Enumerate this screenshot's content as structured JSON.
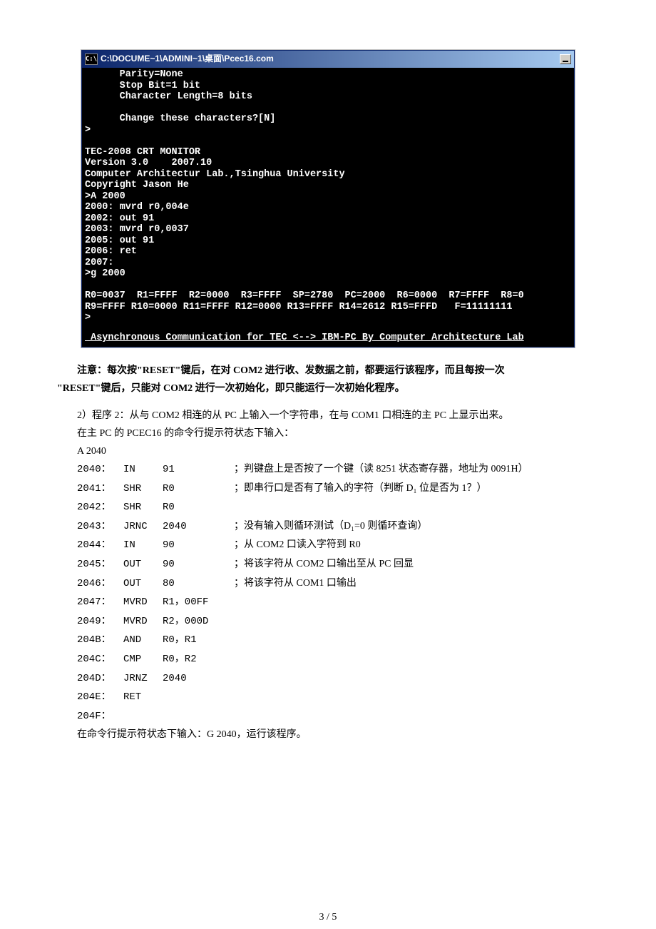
{
  "terminal": {
    "title": "C:\\DOCUME~1\\ADMINI~1\\桌面\\Pcec16.com",
    "icon_label": "C:\\",
    "lines": [
      "      Parity=None",
      "      Stop Bit=1 bit",
      "      Character Length=8 bits",
      "",
      "      Change these characters?[N]",
      ">",
      "",
      "TEC-2008 CRT MONITOR",
      "Version 3.0    2007.10",
      "Computer Architectur Lab.,Tsinghua University",
      "Copyright Jason He",
      ">A 2000",
      "2000: mvrd r0,004e",
      "2002: out 91",
      "2003: mvrd r0,0037",
      "2005: out 91",
      "2006: ret",
      "2007:",
      ">g 2000",
      "",
      "R0=0037  R1=FFFF  R2=0000  R3=FFFF  SP=2780  PC=2000  R6=0000  R7=FFFF  R8=0",
      "R9=FFFF R10=0000 R11=FFFF R12=0000 R13=FFFF R14=2612 R15=FFFD   F=11111111",
      ">"
    ],
    "footer": " Asynchronous Communication for TEC <--> IBM-PC By Computer Architecture Lab"
  },
  "notice": {
    "line1": "注意：每次按\"RESET\"键后，在对 COM2 进行收、发数据之前，都要运行该程序，而且每按一次",
    "line2": "\"RESET\"键后，只能对 COM2 进行一次初始化，即只能运行一次初始化程序。"
  },
  "section": {
    "intro1": "2）程序 2：从与 COM2 相连的从 PC 上输入一个字符串，在与 COM1 口相连的主 PC 上显示出来。",
    "intro2": "在主 PC 的 PCEC16 的命令行提示符状态下输入：",
    "start": "A 2040"
  },
  "code": [
    {
      "addr": "2040：",
      "op": "IN",
      "arg": "91",
      "cmt": "；判键盘上是否按了一个键（读 8251 状态寄存器，地址为 0091H）"
    },
    {
      "addr": "2041：",
      "op": "SHR",
      "arg": "R0",
      "cmt": "；即串行口是否有了输入的字符（判断 D₁ 位是否为 1？）"
    },
    {
      "addr": "2042：",
      "op": "SHR",
      "arg": "R0",
      "cmt": ""
    },
    {
      "addr": "2043：",
      "op": "JRNC",
      "arg": "2040",
      "cmt": "；没有输入则循环测试（D₁=0 则循环查询）"
    },
    {
      "addr": "2044：",
      "op": "IN",
      "arg": "90",
      "cmt": "；从 COM2 口读入字符到 R0"
    },
    {
      "addr": "2045：",
      "op": "OUT",
      "arg": "90",
      "cmt": "；将该字符从 COM2 口输出至从 PC 回显"
    },
    {
      "addr": "2046：",
      "op": "OUT",
      "arg": "80",
      "cmt": "；将该字符从 COM1 口输出"
    },
    {
      "addr": "2047：",
      "op": "MVRD",
      "arg": "R1，00FF",
      "cmt": ""
    },
    {
      "addr": "2049：",
      "op": "MVRD",
      "arg": "R2，000D",
      "cmt": ""
    },
    {
      "addr": "204B：",
      "op": "AND",
      "arg": "R0，R1",
      "cmt": ""
    },
    {
      "addr": "204C：",
      "op": "CMP",
      "arg": "R0，R2",
      "cmt": ""
    },
    {
      "addr": "204D：",
      "op": "JRNZ",
      "arg": "2040",
      "cmt": ""
    },
    {
      "addr": "204E：",
      "op": "RET",
      "arg": "",
      "cmt": ""
    },
    {
      "addr": "204F：",
      "op": "",
      "arg": "",
      "cmt": ""
    }
  ],
  "run_line": "在命令行提示符状态下输入：G 2040，运行该程序。",
  "page_number": "3 / 5"
}
